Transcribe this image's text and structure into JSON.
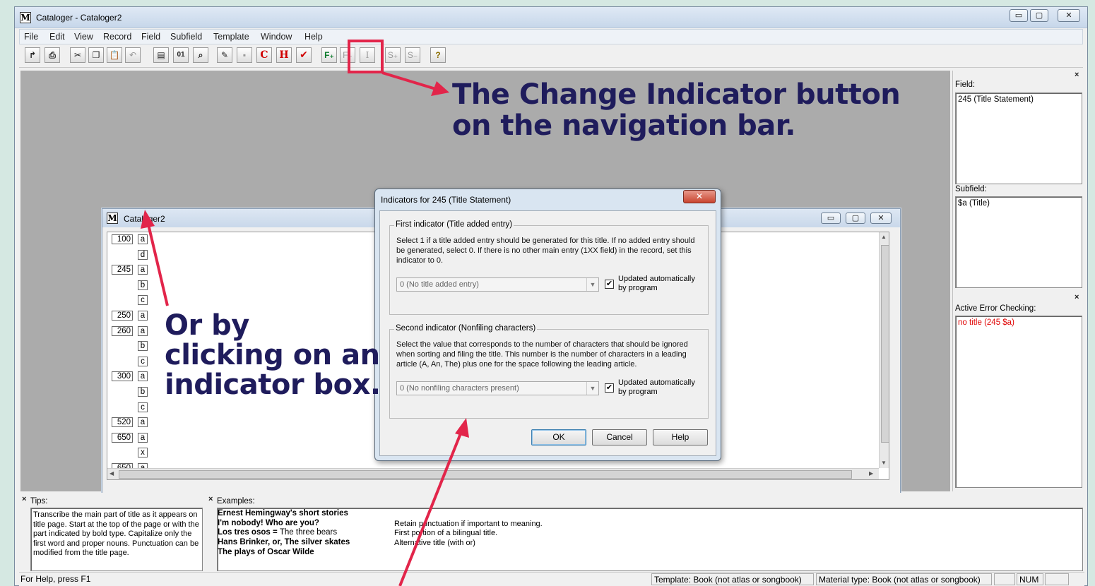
{
  "window": {
    "title": "Cataloger - Cataloger2",
    "buttons": {
      "minimize": "▭",
      "maximize": "▢",
      "close": "✕"
    }
  },
  "menu": [
    "File",
    "Edit",
    "View",
    "Record",
    "Field",
    "Subfield",
    "Template",
    "Window",
    "Help"
  ],
  "toolbar": {
    "buttons": [
      {
        "name": "new-record-button",
        "glyph": "↱"
      },
      {
        "name": "print-button",
        "glyph": "⎙"
      },
      {
        "name": "cut-button",
        "glyph": "✂"
      },
      {
        "name": "copy-button",
        "glyph": "❐"
      },
      {
        "name": "paste-button",
        "glyph": "📋"
      },
      {
        "name": "undo-button",
        "glyph": "↶"
      },
      {
        "name": "marc-view-button",
        "glyph": "▤"
      },
      {
        "name": "binary-view-button",
        "glyph": "01"
      },
      {
        "name": "find-button",
        "glyph": "⌕"
      },
      {
        "name": "import-button",
        "glyph": "✎"
      },
      {
        "name": "save-button",
        "glyph": "▪"
      },
      {
        "name": "check-record-button",
        "glyph": "C"
      },
      {
        "name": "check-heading-button",
        "glyph": "H"
      },
      {
        "name": "spell-check-button",
        "glyph": "✔"
      },
      {
        "name": "add-field-button",
        "glyph": "F₊"
      },
      {
        "name": "delete-field-button",
        "glyph": "F₋"
      },
      {
        "name": "change-indicator-button",
        "glyph": "I"
      },
      {
        "name": "add-subfield-button",
        "glyph": "S₊"
      },
      {
        "name": "delete-subfield-button",
        "glyph": "S₋"
      },
      {
        "name": "help-button",
        "glyph": "?"
      }
    ]
  },
  "annotations": {
    "top_line1": "The Change Indicator button",
    "top_line2": "on the navigation bar.",
    "left_line1": "Or by",
    "left_line2": "clicking on an",
    "left_line3": "indicator box."
  },
  "colors": {
    "annotation_text": "#1f1c5c",
    "annotation_arrow": "#e2254a",
    "error_text": "#e00000"
  },
  "right_panel": {
    "field_label": "Field:",
    "field_value": "245 (Title Statement)",
    "subfield_label": "Subfield:",
    "subfield_value": "$a (Title)",
    "error_label": "Active Error Checking:",
    "error_value": "no title (245 $a)"
  },
  "child_window": {
    "title": "Cataloger2",
    "rows": [
      {
        "tag": "100",
        "sub": "a"
      },
      {
        "tag": "",
        "sub": "d"
      },
      {
        "tag": "245",
        "sub": "a"
      },
      {
        "tag": "",
        "sub": "b"
      },
      {
        "tag": "",
        "sub": "c"
      },
      {
        "tag": "250",
        "sub": "a"
      },
      {
        "tag": "260",
        "sub": "a"
      },
      {
        "tag": "",
        "sub": "b"
      },
      {
        "tag": "",
        "sub": "c"
      },
      {
        "tag": "300",
        "sub": "a"
      },
      {
        "tag": "",
        "sub": "b"
      },
      {
        "tag": "",
        "sub": "c"
      },
      {
        "tag": "520",
        "sub": "a"
      },
      {
        "tag": "650",
        "sub": "a"
      },
      {
        "tag": "",
        "sub": "x"
      },
      {
        "tag": "650",
        "sub": "a"
      }
    ]
  },
  "dialog": {
    "title": "Indicators for 245 (Title Statement)",
    "close": "✕",
    "first": {
      "legend": "First indicator (Title added entry)",
      "description": "Select 1 if a title added entry should be generated for this title. If no added entry should be generated, select 0. If there is no other main entry (1XX field) in the record, set this indicator to 0.",
      "value": "0 (No title added entry)",
      "auto_line1": "Updated automatically",
      "auto_line2": "by program"
    },
    "second": {
      "legend": "Second indicator (Nonfiling characters)",
      "description": "Select the value that corresponds to the number of characters that should be ignored when sorting and filing the title. This number is the number of characters in a leading article (A, An, The) plus one for the space following the leading article.",
      "value": "0 (No nonfiling characters present)",
      "auto_line1": "Updated automatically",
      "auto_line2": "by program"
    },
    "ok": "OK",
    "cancel": "Cancel",
    "help": "Help"
  },
  "tips": {
    "label": "Tips:",
    "text": "Transcribe the main part of title as it appears on title page. Start at the top of the page or with the part indicated by bold type. Capitalize only the first word and proper nouns. Punctuation can be modified from the title page."
  },
  "examples": {
    "label": "Examples:",
    "rows": [
      {
        "bold": "Ernest Hemingway's short stories",
        "plain": "",
        "note": ""
      },
      {
        "bold": "I'm nobody! Who are you?",
        "plain": "",
        "note": "Retain punctuation if important to meaning."
      },
      {
        "bold": "Los tres osos = ",
        "plain": "The three bears",
        "note": "First portion of a bilingual title."
      },
      {
        "bold": "Hans Brinker, or, The silver skates",
        "plain": "",
        "note": "Alternative title (with or)"
      },
      {
        "bold": "The plays of Oscar Wilde",
        "plain": "",
        "note": ""
      }
    ]
  },
  "status": {
    "help": "For Help, press F1",
    "template": "Template: Book (not atlas or songbook)",
    "material": "Material type: Book (not atlas or songbook)",
    "num": "NUM"
  }
}
